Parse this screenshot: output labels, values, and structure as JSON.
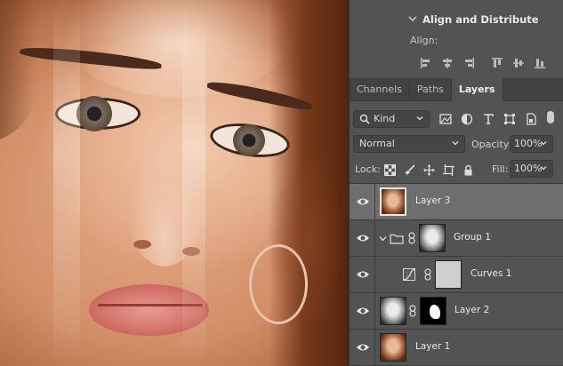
{
  "align_panel": {
    "title": "Align and Distribute",
    "subtitle": "Align:",
    "icons": [
      "align-left-icon",
      "align-horizontal-center-icon",
      "align-right-icon",
      "align-top-icon",
      "align-vertical-center-icon",
      "align-bottom-icon"
    ]
  },
  "tabs": [
    {
      "label": "Channels",
      "active": false
    },
    {
      "label": "Paths",
      "active": false
    },
    {
      "label": "Layers",
      "active": true
    }
  ],
  "filter": {
    "kind_label": "Kind",
    "icons": [
      "pixel-filter-icon",
      "adjustment-filter-icon",
      "type-filter-icon",
      "shape-filter-icon",
      "smart-object-filter-icon"
    ]
  },
  "blend": {
    "mode": "Normal",
    "opacity_label": "Opacity:",
    "opacity_value": "100%"
  },
  "lock": {
    "label": "Lock:",
    "icons": [
      "lock-transparent-icon",
      "lock-paint-icon",
      "lock-position-icon",
      "lock-artboard-icon",
      "lock-all-icon"
    ],
    "fill_label": "Fill:",
    "fill_value": "100%"
  },
  "layers": [
    {
      "name": "Layer 3",
      "selected": true,
      "type": "pixel"
    },
    {
      "name": "Group 1",
      "selected": false,
      "type": "group"
    },
    {
      "name": "Curves 1",
      "selected": false,
      "type": "adjustment"
    },
    {
      "name": "Layer 2",
      "selected": false,
      "type": "masked"
    },
    {
      "name": "Layer 1",
      "selected": false,
      "type": "pixel"
    }
  ],
  "colors": {
    "panel_bg": "#535353",
    "tab_bg": "#424242",
    "selected_row": "#6e6e6e"
  }
}
